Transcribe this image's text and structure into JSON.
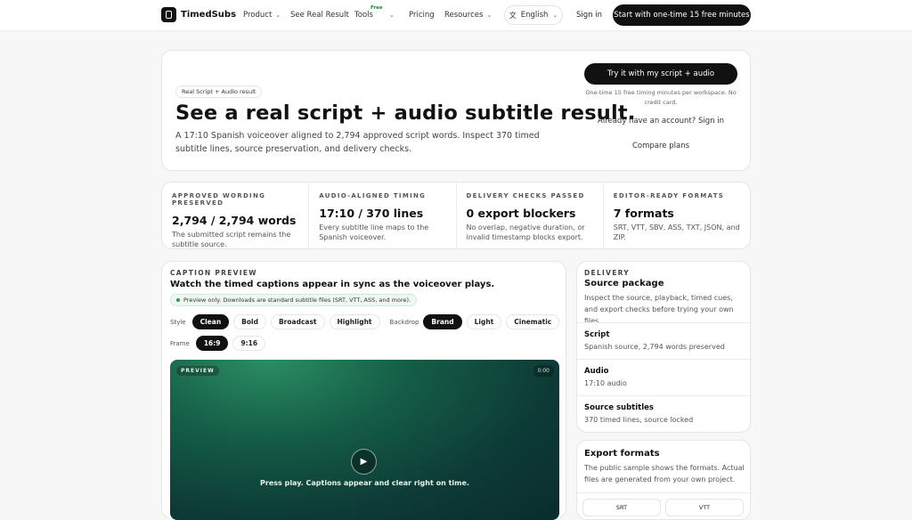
{
  "nav": {
    "brand": "TimedSubs",
    "product": "Product",
    "real_result": "See Real Result",
    "tools": "Tools",
    "tools_badge": "Free",
    "pricing": "Pricing",
    "resources": "Resources",
    "language": "English",
    "sign_in": "Sign in",
    "cta": "Start with one-time 15 free minutes"
  },
  "hero": {
    "chip": "Real Script + Audio result",
    "title": "See a real script + audio subtitle result.",
    "description": "A 17:10 Spanish voiceover aligned to 2,794 approved script words. Inspect 370 timed subtitle lines, source preservation, and delivery checks.",
    "try_button": "Try it with my script + audio",
    "try_note": "One-time 15 free timing minutes per workspace. No credit card.",
    "have_account": "Already have an account? Sign in",
    "compare": "Compare plans"
  },
  "stats": [
    {
      "label": "APPROVED WORDING PRESERVED",
      "value": "2,794 / 2,794 words",
      "desc": "The submitted script remains the subtitle source."
    },
    {
      "label": "AUDIO-ALIGNED TIMING",
      "value": "17:10 / 370 lines",
      "desc": "Every subtitle line maps to the Spanish voiceover."
    },
    {
      "label": "DELIVERY CHECKS PASSED",
      "value": "0 export blockers",
      "desc": "No overlap, negative duration, or invalid timestamp blocks export."
    },
    {
      "label": "EDITOR-READY FORMATS",
      "value": "7 formats",
      "desc": "SRT, VTT, SBV, ASS, TXT, JSON, and ZIP."
    }
  ],
  "preview": {
    "label": "CAPTION PREVIEW",
    "title": "Watch the timed captions appear in sync as the voiceover plays.",
    "note": "Preview only. Downloads are standard subtitle files (SRT, VTT, ASS, and more).",
    "style_label": "Style",
    "styles": [
      "Clean",
      "Bold",
      "Broadcast",
      "Highlight"
    ],
    "backdrop_label": "Backdrop",
    "backdrops": [
      "Brand",
      "Light",
      "Cinematic"
    ],
    "frame_label": "Frame",
    "frames": [
      "16:9",
      "9:16"
    ],
    "video_badge": "PREVIEW",
    "video_time": "0:00",
    "video_caption": "Press play. Captions appear and clear right on time."
  },
  "delivery": {
    "label": "DELIVERY",
    "title": "Source package",
    "desc": "Inspect the source, playback, timed cues, and export checks before trying your own files.",
    "items": [
      {
        "title": "Script",
        "value": "Spanish source, 2,794 words preserved"
      },
      {
        "title": "Audio",
        "value": "17:10 audio"
      },
      {
        "title": "Source subtitles",
        "value": "370 timed lines, source locked"
      }
    ]
  },
  "export": {
    "title": "Export formats",
    "desc": "The public sample shows the formats. Actual files are generated from your own project.",
    "formats": [
      "SRT",
      "VTT"
    ]
  }
}
